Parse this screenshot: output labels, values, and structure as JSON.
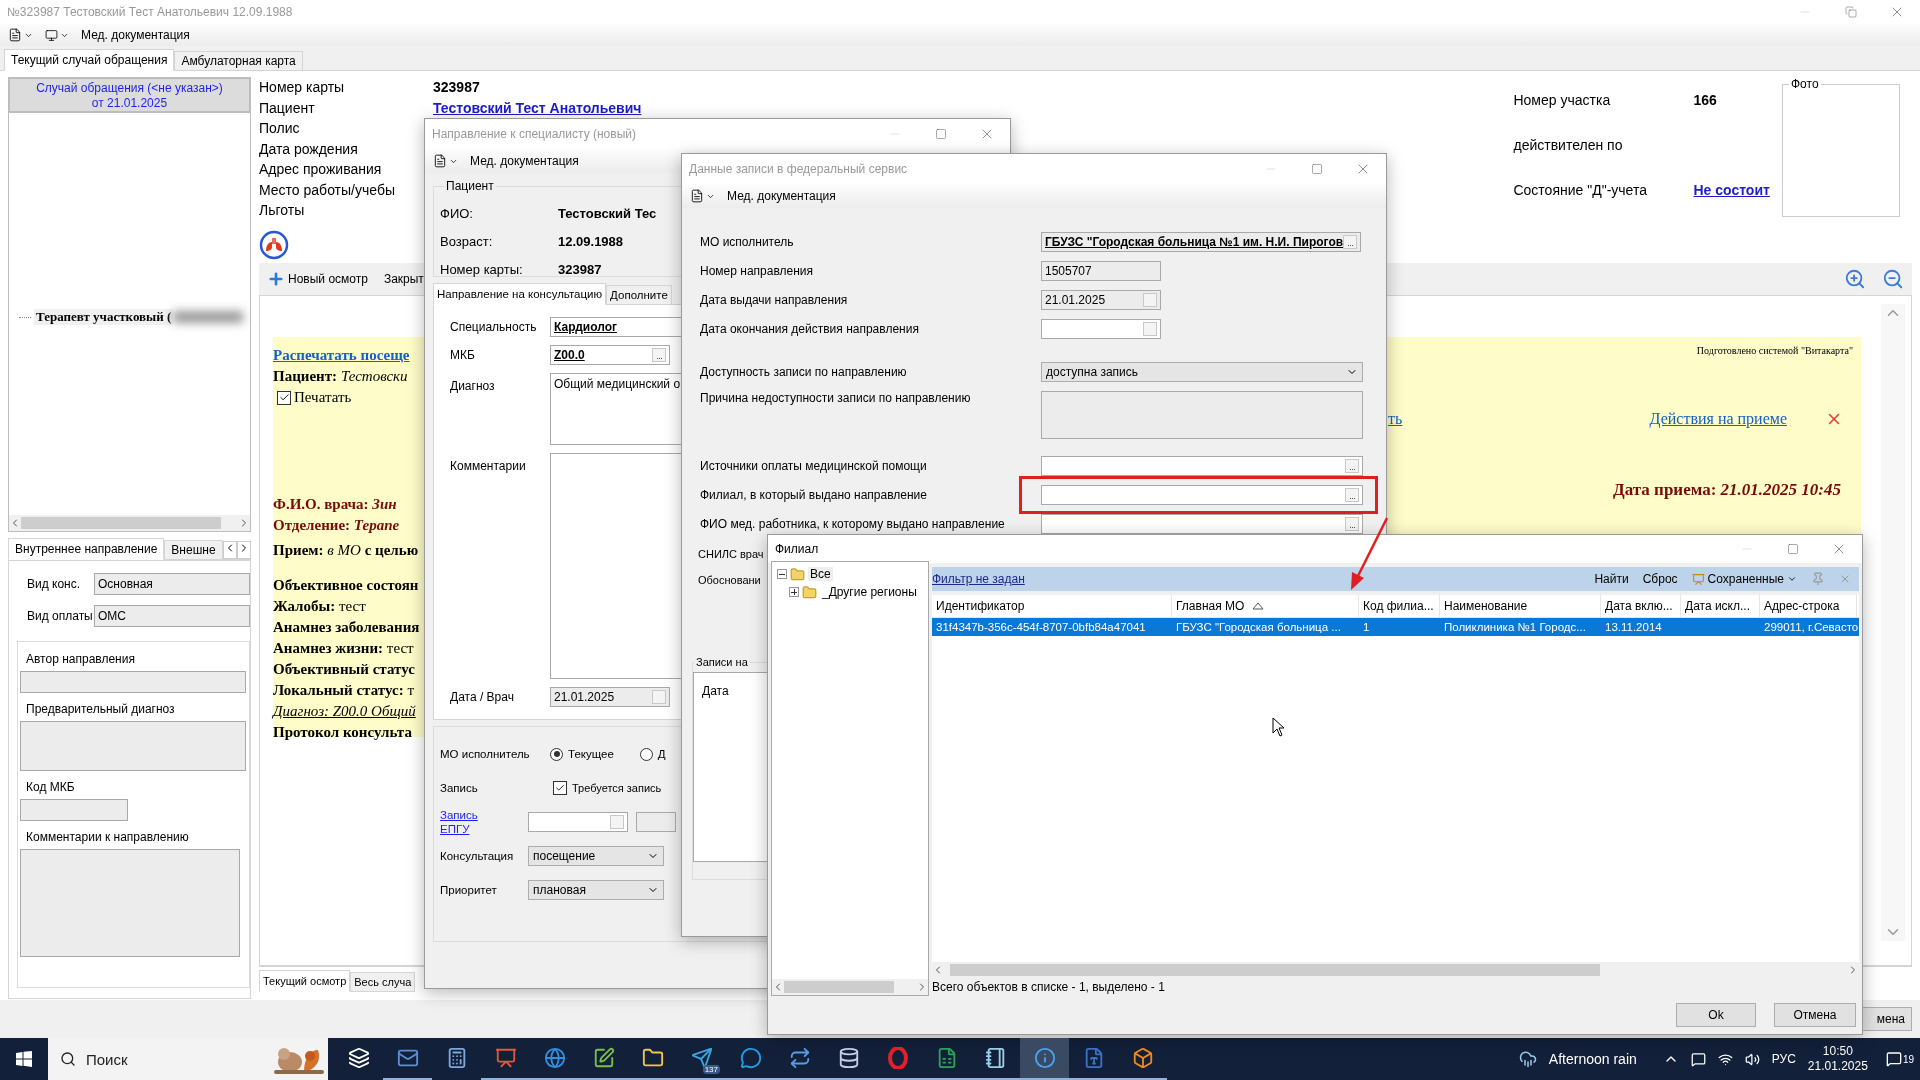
{
  "main_window": {
    "title": "№323987 Тестовский Тест Анатольевич 12.09.1988",
    "toolbar_label": "Мед. документация",
    "tabs": [
      {
        "label": "Текущий случай обращения",
        "selected": true
      },
      {
        "label": "Амбулаторная карта",
        "selected": false
      }
    ],
    "case": {
      "title": "Случай обращения (<не указан>)",
      "date": "от 21.01.2025"
    },
    "tree": [
      {
        "label": "Терапевт участковый (",
        "blurred": true
      }
    ],
    "referral_tabs": [
      {
        "label": "Внутреннее направление",
        "selected": true
      },
      {
        "label": "Внешне",
        "selected": false
      }
    ],
    "referral_fields": [
      {
        "label": "Вид конс.",
        "value": "Основная"
      },
      {
        "label": "Вид оплаты",
        "value": "ОМС"
      }
    ],
    "referral_group": [
      {
        "label": "Автор направления",
        "kind": "field"
      },
      {
        "label": "Предварительный диагноз",
        "kind": "area"
      },
      {
        "label": "Код МКБ",
        "kind": "short"
      },
      {
        "label": "Комментарии к направлению",
        "kind": "large"
      }
    ],
    "patient_info": [
      {
        "label": "Номер карты",
        "value": "323987",
        "kind": "bold"
      },
      {
        "label": "Пациент",
        "value": "Тестовский Тест Анатольевич",
        "kind": "link"
      },
      {
        "label": "Полис"
      },
      {
        "label": "Дата рождения"
      },
      {
        "label": "Адрес проживания"
      },
      {
        "label": "Место работы/учебы"
      },
      {
        "label": "Льготы"
      }
    ],
    "district_info": [
      {
        "label": "Номер участка",
        "value": "166",
        "kind": "bold"
      },
      {
        "label": "действителен по"
      },
      {
        "label": "Состояние \"Д\"-учета",
        "value": "Не состоит",
        "kind": "link"
      }
    ],
    "photo_label": "Фото",
    "actions": [
      {
        "label": "Новый осмотр",
        "kind": "add"
      },
      {
        "label": "Закрыт",
        "kind": "plain"
      }
    ],
    "document": {
      "blocks": [
        [
          {
            "kind": "link",
            "text": "Распечатать посеще"
          },
          {
            "kind": "line",
            "text": "**Пациент:** *Тестовски*"
          },
          {
            "kind": "checkbox",
            "text": "Печатать",
            "checked": true
          }
        ],
        [
          {
            "kind": "maroon",
            "text": "Ф.И.О. врача: *Зин*"
          },
          {
            "kind": "maroon",
            "text": "Отделение: *Терапе*"
          }
        ],
        [
          {
            "kind": "line",
            "text": "**Прием:** *в МО* **с целью**"
          }
        ],
        [
          {
            "kind": "bold",
            "text": "Объективное состоян"
          },
          {
            "kind": "line",
            "text": "**Жалобы:** тест"
          },
          {
            "kind": "bold",
            "text": "Анамнез заболевания"
          },
          {
            "kind": "line",
            "text": "**Анамнез жизни:** тест"
          },
          {
            "kind": "bold",
            "text": "Объективный статус"
          },
          {
            "kind": "line",
            "text": "**Локальный статус:** т"
          },
          {
            "kind": "diagnosis",
            "text": "Диагноз: Z00.0 Общий"
          },
          {
            "kind": "bold",
            "text": "Протокол консульта"
          }
        ]
      ],
      "credit": "Подготовлено системой \"Витакарта\"",
      "side_link": "ть",
      "actions_link": "Действия на приеме",
      "visit_date": {
        "label": "Дата приема:",
        "value": "21.01.2025 10:45"
      }
    },
    "bottom_tabs": [
      {
        "label": "Текущий осмотр",
        "selected": true
      },
      {
        "label": "Весь случа",
        "selected": false
      }
    ],
    "footer_button": "мена"
  },
  "referral_dialog": {
    "title": "Направление к специалисту (новый)",
    "toolbar_label": "Мед. документация",
    "patient_group": "Пациент",
    "patient": [
      {
        "label": "ФИО:",
        "value": "Тестовский Тес"
      },
      {
        "label": "Возраст:",
        "value": "12.09.1988"
      },
      {
        "label": "Номер карты:",
        "value": "323987"
      }
    ],
    "tabs": [
      {
        "label": "Направление на консультацию",
        "selected": true
      },
      {
        "label": "Дополните",
        "selected": false
      }
    ],
    "form": [
      {
        "label": "Специальность",
        "value": "Кардиолог",
        "kind": "lookup"
      },
      {
        "label": "МКБ",
        "value": "Z00.0",
        "kind": "code"
      },
      {
        "label": "Диагноз",
        "value": "Общий медицинский о",
        "kind": "area"
      },
      {
        "label": "Комментарии",
        "kind": "large"
      },
      {
        "label": "Дата / Врач",
        "value": "21.01.2025",
        "kind": "date"
      }
    ],
    "executor": {
      "label": "МО исполнитель",
      "options": [
        {
          "label": "Текущее",
          "selected": true
        },
        {
          "label": "Д",
          "selected": false
        }
      ]
    },
    "booking": {
      "label": "Запись",
      "checkbox": "Требуется запись",
      "checked": true
    },
    "epgu_link": "Запись ЕПГУ",
    "selects": [
      {
        "label": "Консультация",
        "value": "посещение"
      },
      {
        "label": "Приоритет",
        "value": "плановая"
      }
    ]
  },
  "federal_dialog": {
    "title": "Данные записи в федеральный сервис",
    "toolbar_label": "Мед. документация",
    "rows": [
      {
        "label": "МО исполнитель",
        "value": "ГБУЗС \"Городская больница №1 им. Н.И. Пирогов",
        "kind": "lookup"
      },
      {
        "label": "Номер направления",
        "value": "1505707",
        "kind": "text"
      },
      {
        "label": "Дата выдачи направления",
        "value": "21.01.2025",
        "kind": "date"
      },
      {
        "label": "Дата окончания действия направления",
        "kind": "date"
      },
      {
        "label": "Доступность записи по направлению",
        "value": "доступна запись",
        "kind": "select"
      },
      {
        "label": "Причина недоступности записи по направлению",
        "kind": "area"
      },
      {
        "label": "Источники оплаты медицинской помощи",
        "kind": "picker",
        "highlighted": false
      },
      {
        "label": "Филиал, в который выдано направление",
        "kind": "picker",
        "highlighted": true
      },
      {
        "label": "ФИО мед. работника, к которому выдано направление",
        "kind": "picker",
        "highlighted": false
      }
    ],
    "cut_labels": [
      "СНИЛС врач",
      "Обосновани"
    ],
    "records_group": {
      "label": "Записи на",
      "column": "Дата"
    }
  },
  "branch_dialog": {
    "title": "Филиал",
    "tree": [
      {
        "label": "Все",
        "expanded": true,
        "children": [
          {
            "label": "_Другие регионы",
            "expanded": false
          }
        ]
      }
    ],
    "filter_link": "Фильтр не задан",
    "toolbar": [
      {
        "label": "Найти",
        "kind": "text"
      },
      {
        "label": "Сброс",
        "kind": "text"
      },
      {
        "label": "Сохраненные",
        "kind": "menu"
      }
    ],
    "columns": [
      {
        "label": "Идентификатор",
        "sorted": false
      },
      {
        "label": "Главная МО",
        "sorted": true
      },
      {
        "label": "Код филиа...",
        "sorted": false
      },
      {
        "label": "Наименование",
        "sorted": false
      },
      {
        "label": "Дата вклю...",
        "sorted": false
      },
      {
        "label": "Дата искл...",
        "sorted": false
      },
      {
        "label": "Адрес-строка",
        "sorted": false
      }
    ],
    "rows": [
      {
        "selected": true,
        "cells": [
          "31f4347b-356c-454f-8707-0bfb84a47041",
          "ГБУЗС \"Городская больница ...",
          "1",
          "Поликлиника №1 Городс...",
          "13.11.2014",
          null,
          "299011, г.Севасто"
        ]
      }
    ],
    "status": "Всего объектов в списке - 1, выделено - 1",
    "buttons": [
      "Ok",
      "Отмена"
    ]
  },
  "taskbar": {
    "search_placeholder": "Поиск",
    "apps": [
      {
        "kind": "taskview",
        "running": false,
        "selected": false
      },
      {
        "kind": "mail",
        "running": true,
        "selected": false
      },
      {
        "kind": "calculator",
        "running": false,
        "selected": false
      },
      {
        "kind": "presentation",
        "running": true,
        "selected": false
      },
      {
        "kind": "browser",
        "running": true,
        "selected": false
      },
      {
        "kind": "editor",
        "running": true,
        "selected": false
      },
      {
        "kind": "folder",
        "running": true,
        "selected": false
      },
      {
        "kind": "messenger",
        "running": true,
        "selected": false,
        "badge": "137"
      },
      {
        "kind": "chat",
        "running": true,
        "selected": false
      },
      {
        "kind": "sync",
        "running": true,
        "selected": false
      },
      {
        "kind": "database",
        "running": true,
        "selected": false
      },
      {
        "kind": "opera",
        "running": true,
        "selected": false
      },
      {
        "kind": "sheet",
        "running": true,
        "selected": false
      },
      {
        "kind": "notes",
        "running": true,
        "selected": false
      },
      {
        "kind": "info",
        "running": true,
        "selected": true
      },
      {
        "kind": "document",
        "running": true,
        "selected": false
      },
      {
        "kind": "box",
        "running": true,
        "selected": false
      }
    ],
    "weather": "Afternoon rain",
    "language": "РУС",
    "time": "10:50",
    "date": "21.01.2025",
    "notifications": "19"
  }
}
